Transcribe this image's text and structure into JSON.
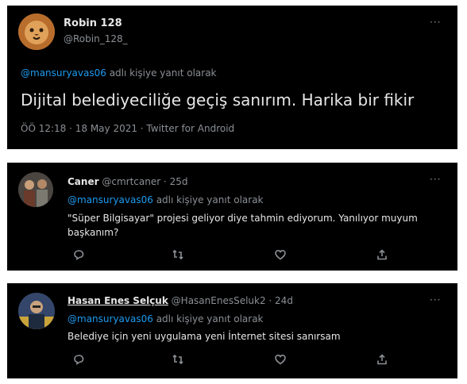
{
  "tweet1": {
    "name": "Robin 128",
    "handle": "@Robin_128_",
    "reply_mention": "@mansuryavas06",
    "reply_suffix": " adlı kişiye yanıt olarak",
    "text": "Dijital belediyeciliğe geçiş sanırım. Harika bir fikir",
    "meta": "ÖÖ 12:18 · 18 May 2021 · Twitter for Android",
    "more": "···"
  },
  "tweet2": {
    "name": "Caner",
    "handle": "@cmrtcaner · 25d",
    "reply_mention": "@mansuryavas06",
    "reply_suffix": " adlı kişiye yanıt olarak",
    "text": "\"Süper Bilgisayar\" projesi geliyor diye tahmin ediyorum. Yanılıyor muyum başkanım?",
    "more": "···"
  },
  "tweet3": {
    "name": "Hasan Enes Selçuk",
    "handle": "@HasanEnesSeluk2 · 24d",
    "reply_mention": "@mansuryavas06",
    "reply_suffix": " adlı kişiye yanıt olarak",
    "text": "Belediye için yeni uygulama yeni İnternet sitesi sanırsam",
    "more": "···"
  },
  "icons": [
    "reply-icon",
    "retweet-icon",
    "like-icon",
    "share-icon"
  ],
  "colors": {
    "background": "#000000",
    "mention": "#1d9bf0",
    "muted": "#8b8f94"
  }
}
